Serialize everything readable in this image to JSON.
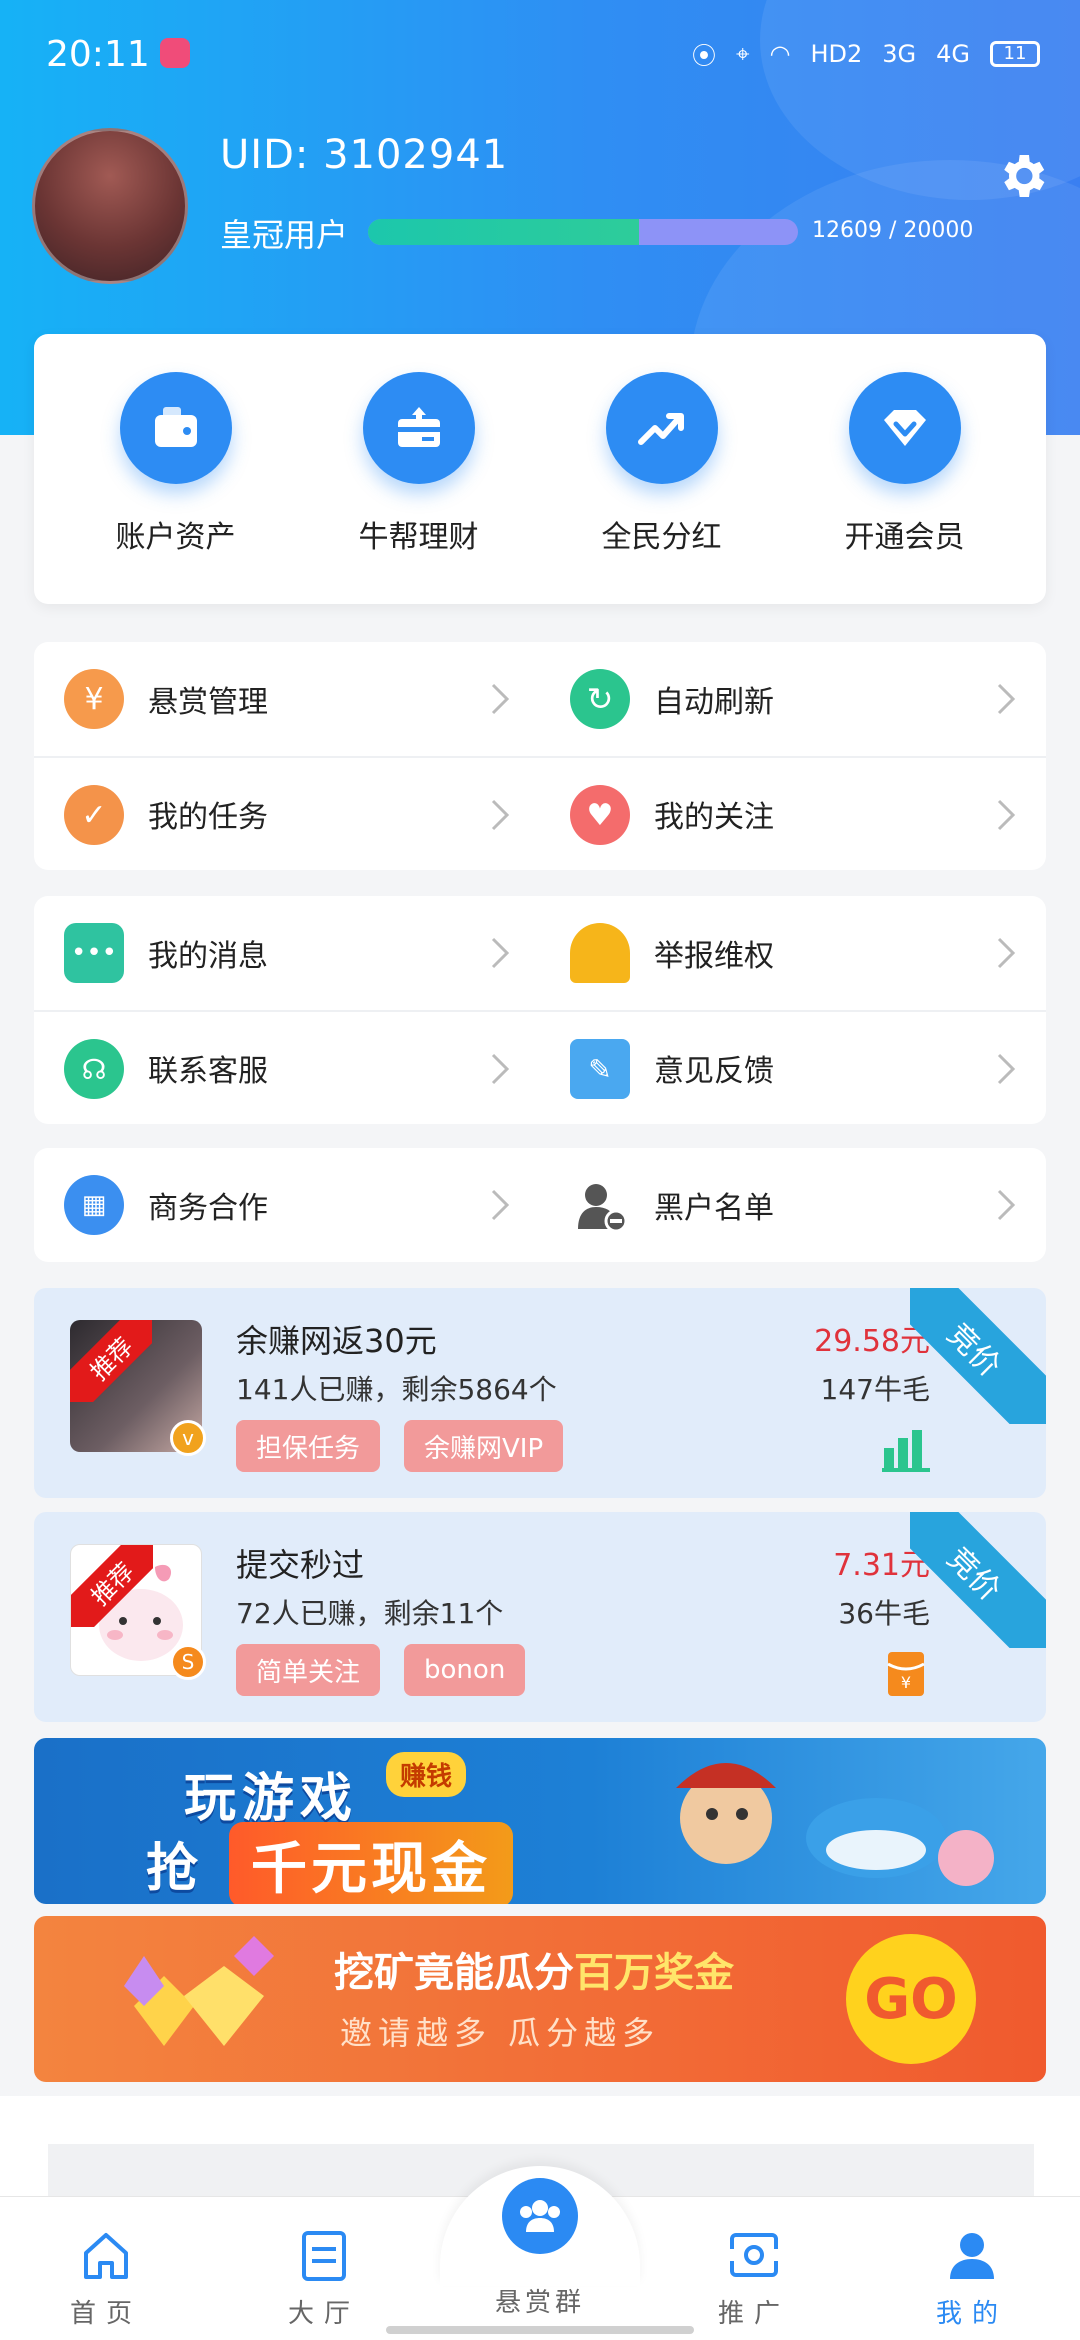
{
  "status": {
    "time": "20:11",
    "network": [
      "HD2",
      "3G",
      "4G"
    ],
    "battery": "11"
  },
  "profile": {
    "uid": "UID: 3102941",
    "rank": "皇冠用户",
    "xp_text": "12609 / 20000",
    "xp_fraction": 0.6305
  },
  "quick": [
    {
      "label": "账户资产",
      "icon": "wallet-icon"
    },
    {
      "label": "牛帮理财",
      "icon": "finance-icon"
    },
    {
      "label": "全民分红",
      "icon": "trend-icon"
    },
    {
      "label": "开通会员",
      "icon": "diamond-icon"
    }
  ],
  "menu1": [
    {
      "label": "悬赏管理",
      "icon": "money-bag-icon",
      "color": "#f69a4c"
    },
    {
      "label": "自动刷新",
      "icon": "refresh-icon",
      "color": "#2bc58e"
    },
    {
      "label": "我的任务",
      "icon": "task-check-icon",
      "color": "#f4934a"
    },
    {
      "label": "我的关注",
      "icon": "heart-icon",
      "color": "#f46c6c"
    }
  ],
  "menu2": [
    {
      "label": "我的消息",
      "icon": "message-icon",
      "color": "#2fc3a0"
    },
    {
      "label": "举报维权",
      "icon": "alarm-icon",
      "color": "#f6b51a"
    },
    {
      "label": "联系客服",
      "icon": "headset-icon",
      "color": "#2bc58e"
    },
    {
      "label": "意见反馈",
      "icon": "feedback-icon",
      "color": "#4aa8f0"
    }
  ],
  "menu3": [
    {
      "label": "商务合作",
      "icon": "handshake-icon",
      "color": "#3b8ff0"
    },
    {
      "label": "黑户名单",
      "icon": "blacklist-icon",
      "color": "#555555"
    }
  ],
  "tasks": [
    {
      "ribbon": "推荐",
      "badge": "v",
      "title": "余赚网返30元",
      "sub": "141人已赚，剩余5864个",
      "tags": [
        "担保任务",
        "余赚网VIP"
      ],
      "price": "29.58元",
      "points": "147牛毛",
      "corner": "竞价",
      "icon": "bar-chart-icon"
    },
    {
      "ribbon": "推荐",
      "badge": "S",
      "title": "提交秒过",
      "sub": "72人已赚，剩余11个",
      "tags": [
        "简单关注",
        "bonon"
      ],
      "price": "7.31元",
      "points": "36牛毛",
      "corner": "竞价",
      "icon": "red-packet-icon"
    }
  ],
  "banner_game": {
    "line1": "玩游戏",
    "chip": "赚钱",
    "line2": "抢",
    "cash": "千元现金"
  },
  "banner_mine": {
    "title_a": "挖矿竟能瓜分",
    "title_b": "百万奖金",
    "sub": "邀请越多 瓜分越多",
    "go": "GO"
  },
  "tabbar": {
    "home": "首页",
    "hall": "大厅",
    "center": "悬赏群",
    "promote": "推广",
    "mine": "我的"
  },
  "colors": {
    "accent": "#2b8af3",
    "price_red": "#e0323b",
    "corner_blue": "#28a4dd"
  }
}
